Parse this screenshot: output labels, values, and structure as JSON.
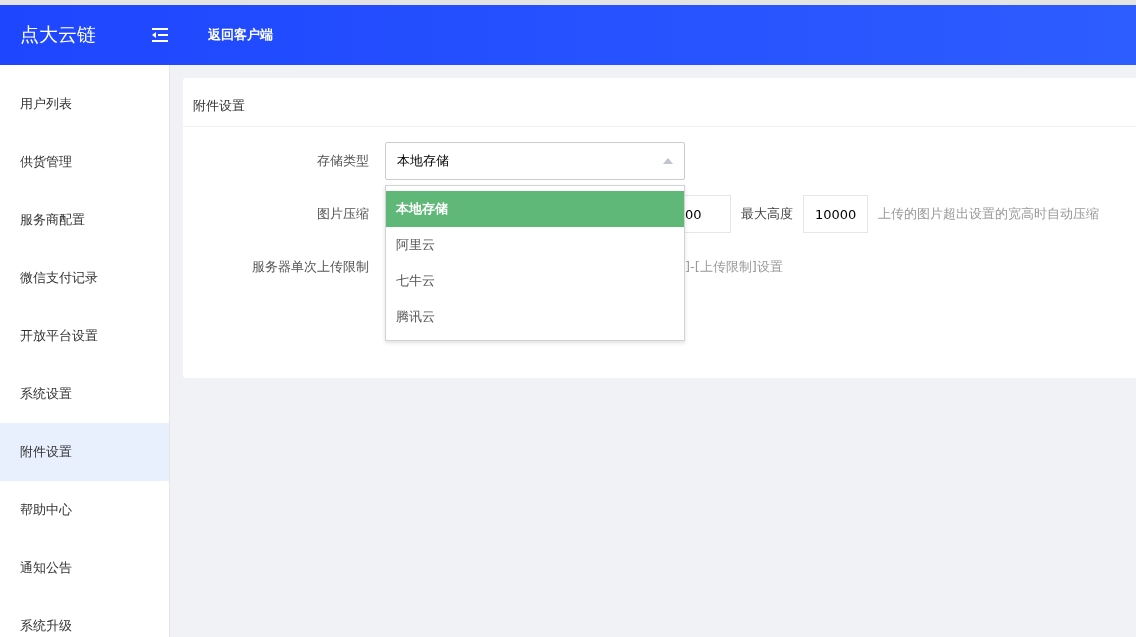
{
  "header": {
    "brand": "点大云链",
    "back_link": "返回客户端"
  },
  "sidebar": {
    "items": [
      {
        "label": "用户列表",
        "selected": false
      },
      {
        "label": "供货管理",
        "selected": false
      },
      {
        "label": "服务商配置",
        "selected": false
      },
      {
        "label": "微信支付记录",
        "selected": false
      },
      {
        "label": "开放平台设置",
        "selected": false
      },
      {
        "label": "系统设置",
        "selected": false
      },
      {
        "label": "附件设置",
        "selected": true
      },
      {
        "label": "帮助中心",
        "selected": false
      },
      {
        "label": "通知公告",
        "selected": false
      },
      {
        "label": "系统升级",
        "selected": false
      }
    ]
  },
  "card": {
    "title": "附件设置",
    "storage": {
      "label": "存储类型",
      "value": "本地存储",
      "expanded": true,
      "options": [
        {
          "label": "本地存储",
          "selected": true
        },
        {
          "label": "阿里云",
          "selected": false
        },
        {
          "label": "七牛云",
          "selected": false
        },
        {
          "label": "腾讯云",
          "selected": false
        }
      ]
    },
    "compress": {
      "label": "图片压缩",
      "width_value": "00",
      "height_label": "最大高度",
      "height_value": "10000",
      "hint": "上传的图片超出设置的宽高时自动压缩"
    },
    "upload_limit": {
      "label": "服务器单次上传限制",
      "hint": "]-[上传限制]设置"
    }
  }
}
